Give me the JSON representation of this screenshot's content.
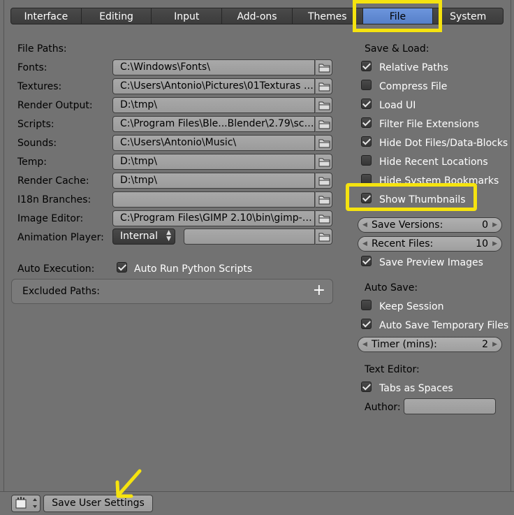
{
  "tabs": [
    "Interface",
    "Editing",
    "Input",
    "Add-ons",
    "Themes",
    "File",
    "System"
  ],
  "active_tab": "File",
  "file_paths": {
    "title": "File Paths:",
    "rows": [
      {
        "label": "Fonts:",
        "value": "C:\\Windows\\Fonts\\"
      },
      {
        "label": "Textures:",
        "value": "C:\\Users\\Antonio\\Pictures\\01Texturas Ur..."
      },
      {
        "label": "Render Output:",
        "value": "D:\\tmp\\"
      },
      {
        "label": "Scripts:",
        "value": "C:\\Program Files\\Ble...Blender\\2.79\\scripts\\"
      },
      {
        "label": "Sounds:",
        "value": "C:\\Users\\Antonio\\Music\\"
      },
      {
        "label": "Temp:",
        "value": "D:\\tmp\\"
      },
      {
        "label": "Render Cache:",
        "value": "D:\\tmp\\"
      },
      {
        "label": "I18n Branches:",
        "value": ""
      },
      {
        "label": "Image Editor:",
        "value": "C:\\Program Files\\GIMP 2.10\\bin\\gimp-2.1..."
      }
    ],
    "animation_player_label": "Animation Player:",
    "animation_player_value": "Internal"
  },
  "auto_execution": {
    "label": "Auto Execution:",
    "checkbox_label": "Auto Run Python Scripts",
    "checked": true
  },
  "excluded_paths": "Excluded Paths:",
  "save_load": {
    "title": "Save & Load:",
    "options": [
      {
        "label": "Relative Paths",
        "checked": true
      },
      {
        "label": "Compress File",
        "checked": false
      },
      {
        "label": "Load UI",
        "checked": true
      },
      {
        "label": "Filter File Extensions",
        "checked": true
      },
      {
        "label": "Hide Dot Files/Data-Blocks",
        "checked": true
      },
      {
        "label": "Hide Recent Locations",
        "checked": false
      },
      {
        "label": "Hide System Bookmarks",
        "checked": false
      },
      {
        "label": "Show Thumbnails",
        "checked": true
      }
    ],
    "save_versions_label": "Save Versions:",
    "save_versions_value": "0",
    "recent_files_label": "Recent Files:",
    "recent_files_value": "10",
    "save_preview_label": "Save Preview Images",
    "save_preview_checked": true
  },
  "auto_save": {
    "title": "Auto Save:",
    "keep_session_label": "Keep Session",
    "keep_session_checked": false,
    "auto_save_temp_label": "Auto Save Temporary Files",
    "auto_save_temp_checked": true,
    "timer_label": "Timer (mins):",
    "timer_value": "2"
  },
  "text_editor": {
    "title": "Text Editor:",
    "tabs_as_spaces_label": "Tabs as Spaces",
    "tabs_as_spaces_checked": true,
    "author_label": "Author:",
    "author_value": ""
  },
  "bottom": {
    "save_button": "Save User Settings"
  },
  "colors": {
    "background": "#727272",
    "active_tab": "#5680c9",
    "highlight": "#f5e30f"
  }
}
